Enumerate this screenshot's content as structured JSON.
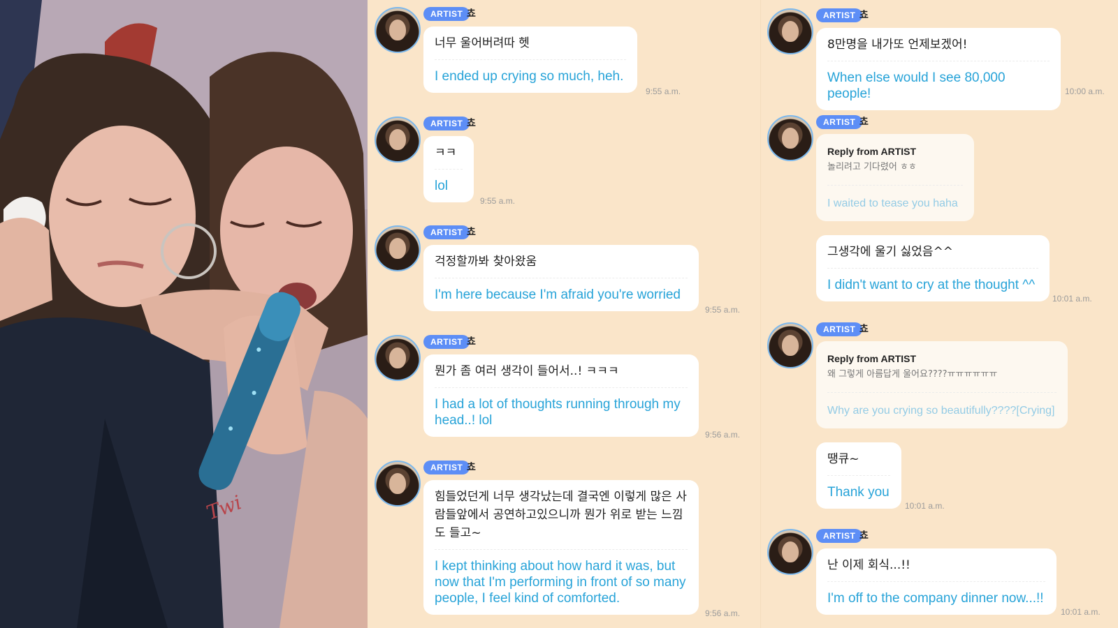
{
  "photo": {
    "description_icon": "concert-photo",
    "shirt_text": "Twi"
  },
  "badge_label": "ARTIST",
  "artist_name": "쵸",
  "reply_label": "Reply from ARTIST",
  "left_messages": [
    {
      "ko": "너무 울어버려따 헷",
      "en": "I ended up crying so much, heh.",
      "time": "9:55 a.m."
    },
    {
      "ko": "ㅋㅋ",
      "en": "lol",
      "time": "9:55 a.m."
    },
    {
      "ko": "걱정할까봐 찾아왔움",
      "en": "I'm here because I'm afraid you're worried",
      "time": "9:55 a.m."
    },
    {
      "ko": "뭔가 좀 여러 생각이 들어서..! ㅋㅋㅋ",
      "en": "I had a lot of thoughts running through my head..! lol",
      "time": "9:56 a.m."
    },
    {
      "ko": "힘들었던게 너무 생각났는데 결국엔 이렇게 많은 사람들앞에서 공연하고있으니까 뭔가 위로 받는 느낌도 들고~",
      "en": "I kept thinking about how hard it was, but now that I'm performing in front of so many people, I feel kind of comforted.",
      "time": "9:56 a.m."
    }
  ],
  "right_messages": [
    {
      "ko": "8만명을 내가또 언제보겠어!",
      "en": "When else would I see 80,000 people!",
      "time": "10:00 a.m."
    },
    {
      "reply_orig": "놀리려고 기다렸어 ㅎㅎ",
      "en": "I waited to tease you haha"
    },
    {
      "ko": "그생각에 울기 싫었음^^",
      "en": "I didn't want to cry at the thought ^^",
      "time": "10:01 a.m."
    },
    {
      "reply_orig": "왜 그렇게 아름답게 울어요????ㅠㅠㅠㅠㅠㅠ",
      "en": "Why are you crying so beautifully????[Crying]"
    },
    {
      "ko": "땡큐~",
      "en": "Thank you",
      "time": "10:01 a.m."
    },
    {
      "ko": "난 이제 회식...!!",
      "en": "I'm off to the company dinner now...!!",
      "time": "10:01 a.m."
    }
  ],
  "colors": {
    "background": "#fae5c9",
    "badge": "#5d8ef6",
    "translation": "#27a3d8",
    "avatar_ring": "#7cb8ec"
  }
}
